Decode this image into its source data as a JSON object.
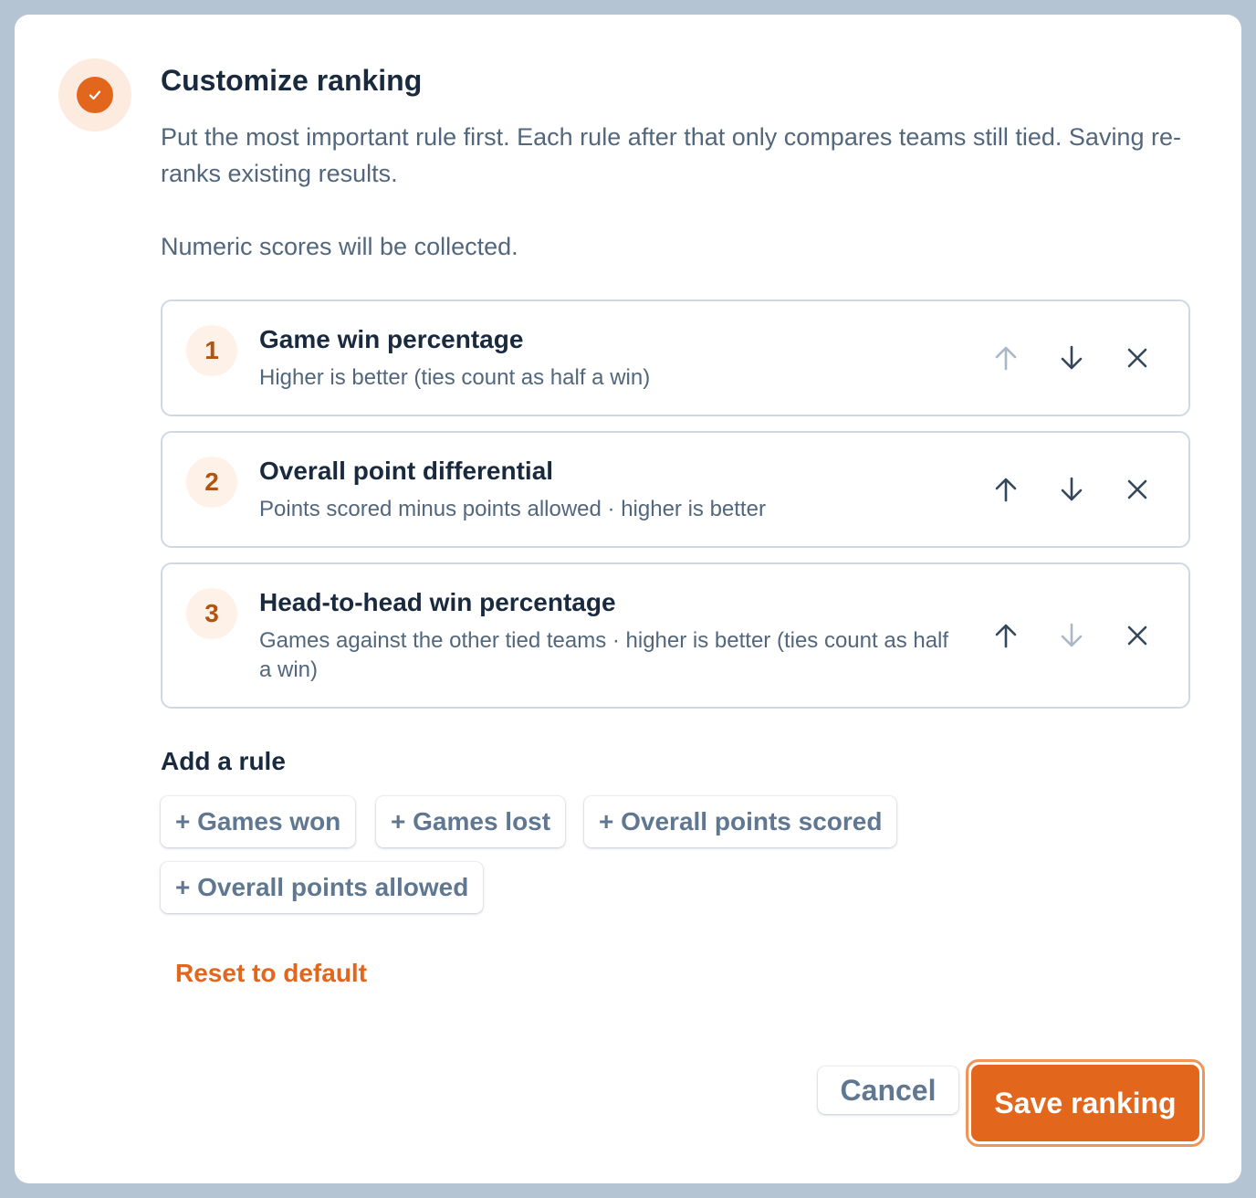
{
  "dialog": {
    "title": "Customize ranking",
    "description": "Put the most important rule first. Each rule after that only compares teams still tied. Saving re-ranks existing results.",
    "note": "Numeric scores will be collected.",
    "header_icon": "check-icon",
    "accent_color": "#e2661b"
  },
  "rules": [
    {
      "number": "1",
      "title": "Game win percentage",
      "subtitle": "Higher is better (ties count as half a win)",
      "move_up_enabled": false,
      "move_down_enabled": true
    },
    {
      "number": "2",
      "title": "Overall point differential",
      "subtitle": "Points scored minus points allowed · higher is better",
      "move_up_enabled": true,
      "move_down_enabled": true
    },
    {
      "number": "3",
      "title": "Head-to-head win percentage",
      "subtitle": "Games against the other tied teams · higher is better (ties count as half a win)",
      "move_up_enabled": true,
      "move_down_enabled": false
    }
  ],
  "rule_icons": {
    "move_up": "arrow-up-icon",
    "move_down": "arrow-down-icon",
    "remove": "close-icon"
  },
  "add_rule": {
    "label": "Add a rule",
    "options": [
      "+ Games won",
      "+ Games lost",
      "+ Overall points scored",
      "+ Overall points allowed"
    ]
  },
  "actions": {
    "reset": "Reset to default",
    "cancel": "Cancel",
    "save": "Save ranking"
  }
}
